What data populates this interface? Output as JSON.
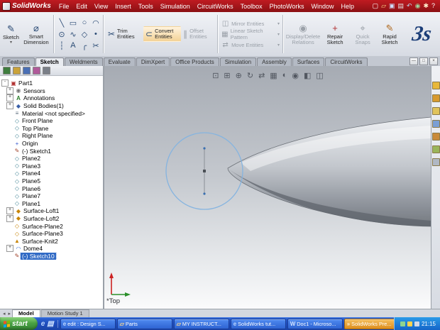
{
  "titlebar": {
    "app_name": "SolidWorks",
    "menus": [
      "File",
      "Edit",
      "View",
      "Insert",
      "Tools",
      "Simulation",
      "CircuitWorks",
      "Toolbox",
      "PhotoWorks",
      "Window",
      "Help"
    ],
    "icons": [
      {
        "name": "new-icon",
        "glyph": "▢",
        "color": "#ffffff"
      },
      {
        "name": "open-icon",
        "glyph": "▱",
        "color": "#ffd98a"
      },
      {
        "name": "save-icon",
        "glyph": "▣",
        "color": "#cfe0ff"
      },
      {
        "name": "print-icon",
        "glyph": "▤",
        "color": "#e8e8e8"
      },
      {
        "name": "undo-icon",
        "glyph": "↶",
        "color": "#bcd4ee"
      },
      {
        "name": "rebuild-icon",
        "glyph": "◉",
        "color": "#9fd89f"
      },
      {
        "name": "options-icon",
        "glyph": "✱",
        "color": "#ffeecc"
      },
      {
        "name": "help-icon",
        "glyph": "?",
        "color": "#ffffff"
      }
    ]
  },
  "command_manager": {
    "sketch": {
      "label": "Sketch",
      "glyph": "✎"
    },
    "smart_dimension": {
      "label": "Smart Dimension",
      "glyph": "⌀"
    },
    "entity_tools": [
      {
        "name": "line-icon",
        "glyph": "╲"
      },
      {
        "name": "rectangle-icon",
        "glyph": "▭"
      },
      {
        "name": "circle-icon",
        "glyph": "○"
      },
      {
        "name": "arc-icon",
        "glyph": "◠"
      },
      {
        "name": "ellipse-icon",
        "glyph": "⊙"
      },
      {
        "name": "spline-icon",
        "glyph": "∿"
      },
      {
        "name": "polygon-icon",
        "glyph": "◇"
      },
      {
        "name": "point-icon",
        "glyph": "•"
      },
      {
        "name": "centerline-icon",
        "glyph": "┆"
      },
      {
        "name": "text-icon",
        "glyph": "A"
      },
      {
        "name": "fillet-icon",
        "glyph": "╭"
      },
      {
        "name": "trim-small-icon",
        "glyph": "✂"
      }
    ],
    "trim": {
      "label": "Trim Entities",
      "glyph": "✂"
    },
    "convert": {
      "label": "Convert Entities",
      "glyph": "⊂"
    },
    "offset": {
      "label": "Offset Entities",
      "glyph": "∥"
    },
    "pattern_tools": [
      {
        "name": "mirror-entities-button",
        "label": "Mirror Entities",
        "glyph": "◫"
      },
      {
        "name": "linear-sketch-pattern-button",
        "label": "Linear Sketch Pattern",
        "glyph": "▦"
      },
      {
        "name": "move-entities-button",
        "label": "Move Entities",
        "glyph": "⇄"
      }
    ],
    "display_delete": {
      "label": "Display/Delete Relations",
      "glyph": "◉"
    },
    "repair": {
      "label": "Repair Sketch",
      "glyph": "+"
    },
    "quick_snaps": {
      "label": "Quick Snaps",
      "glyph": "⌖"
    },
    "rapid_sketch": {
      "label": "Rapid Sketch",
      "glyph": "✎"
    },
    "logo_text": "3s"
  },
  "tab_bar": {
    "tabs": [
      {
        "label": "Features"
      },
      {
        "label": "Sketch",
        "active": true
      },
      {
        "label": "Weldments"
      },
      {
        "label": "Evaluate"
      },
      {
        "label": "DimXpert"
      },
      {
        "label": "Office Products"
      },
      {
        "label": "Simulation"
      },
      {
        "label": "Assembly"
      },
      {
        "label": "Surfaces"
      },
      {
        "label": "CircuitWorks"
      }
    ],
    "window_controls": [
      {
        "name": "minimize-button",
        "glyph": "—"
      },
      {
        "name": "restore-button",
        "glyph": "□"
      },
      {
        "name": "close-button",
        "glyph": "×"
      }
    ]
  },
  "feature_tree": {
    "header_icons": [
      {
        "name": "featuremanager-tab-icon",
        "color": "#3f7d3f"
      },
      {
        "name": "propertymanager-tab-icon",
        "color": "#caa23a"
      },
      {
        "name": "configurationmanager-tab-icon",
        "color": "#4a6fb5"
      },
      {
        "name": "dimxpertmanager-tab-icon",
        "color": "#b05a9a"
      },
      {
        "name": "displaymanager-tab-icon",
        "color": "#7a7f88"
      }
    ],
    "root": {
      "label": "Part1",
      "expander": "-",
      "glyph": "▣"
    },
    "items": [
      {
        "label": "Sensors",
        "icon": "sensors",
        "glyph": "◉",
        "expander": "+"
      },
      {
        "label": "Annotations",
        "icon": "annotations",
        "glyph": "A",
        "expander": "+"
      },
      {
        "label": "Solid Bodies(1)",
        "icon": "bodies",
        "glyph": "◆",
        "expander": "+"
      },
      {
        "label": "Material <not specified>",
        "icon": "material",
        "glyph": "≡"
      },
      {
        "label": "Front Plane",
        "icon": "plane",
        "glyph": "◇"
      },
      {
        "label": "Top Plane",
        "icon": "plane",
        "glyph": "◇"
      },
      {
        "label": "Right Plane",
        "icon": "plane",
        "glyph": "◇"
      },
      {
        "label": "Origin",
        "icon": "origin",
        "glyph": "+"
      },
      {
        "label": "(-) Sketch1",
        "icon": "sketch",
        "glyph": "✎"
      },
      {
        "label": "Plane2",
        "icon": "plane",
        "glyph": "◇"
      },
      {
        "label": "Plane3",
        "icon": "plane",
        "glyph": "◇"
      },
      {
        "label": "Plane4",
        "icon": "plane",
        "glyph": "◇"
      },
      {
        "label": "Plane5",
        "icon": "plane",
        "glyph": "◇"
      },
      {
        "label": "Plane6",
        "icon": "plane",
        "glyph": "◇"
      },
      {
        "label": "Plane7",
        "icon": "plane",
        "glyph": "◇"
      },
      {
        "label": "Plane1",
        "icon": "plane",
        "glyph": "◇"
      },
      {
        "label": "Surface-Loft1",
        "icon": "surface",
        "glyph": "◆",
        "expander": "+"
      },
      {
        "label": "Surface-Loft2",
        "icon": "surface",
        "glyph": "◆",
        "expander": "+"
      },
      {
        "label": "Surface-Plane2",
        "icon": "surface",
        "glyph": "◇"
      },
      {
        "label": "Surface-Plane3",
        "icon": "surface",
        "glyph": "◇"
      },
      {
        "label": "Surface-Knit2",
        "icon": "surface",
        "glyph": "▲"
      },
      {
        "label": "Dome4",
        "icon": "dome",
        "glyph": "◠",
        "expander": "+"
      },
      {
        "label": "(-) Sketch10",
        "icon": "sketch",
        "glyph": "✎",
        "selected": true
      }
    ]
  },
  "viewport": {
    "view_label": "*Top",
    "toolbar_icons": [
      {
        "name": "zoom-fit-icon",
        "glyph": "⊡"
      },
      {
        "name": "zoom-area-icon",
        "glyph": "⊞"
      },
      {
        "name": "zoom-in-out-icon",
        "glyph": "⊕"
      },
      {
        "name": "rotate-view-icon",
        "glyph": "↻"
      },
      {
        "name": "pan-icon",
        "glyph": "⇄"
      },
      {
        "name": "view-orientation-icon",
        "glyph": "▦"
      },
      {
        "name": "display-style-icon",
        "glyph": "◐"
      },
      {
        "name": "hide-show-items-icon",
        "glyph": "◉"
      },
      {
        "name": "shadows-icon",
        "glyph": "◧"
      },
      {
        "name": "section-view-icon",
        "glyph": "◫"
      }
    ]
  },
  "task_pane": {
    "icons": [
      {
        "name": "solidworks-resources-icon",
        "color": "#e8b83a"
      },
      {
        "name": "design-library-icon",
        "color": "#d89a2e"
      },
      {
        "name": "file-explorer-icon",
        "color": "#e0c35a"
      },
      {
        "name": "search-icon",
        "color": "#7a9fd4"
      },
      {
        "name": "view-palette-icon",
        "color": "#c98a3a"
      },
      {
        "name": "appearances-icon",
        "color": "#9ab55a"
      },
      {
        "name": "custom-properties-icon",
        "color": "#b0b8c4"
      }
    ]
  },
  "document_tabs": {
    "nav_icons": [
      {
        "name": "tab-scroll-left-icon",
        "glyph": "◂"
      },
      {
        "name": "tab-scroll-right-icon",
        "glyph": "▸"
      }
    ],
    "tabs": [
      {
        "label": "Model",
        "active": true
      },
      {
        "label": "Motion Study 1"
      }
    ]
  },
  "taskbar": {
    "start_label": "start",
    "quick_launch": [
      {
        "name": "internet-explorer-icon",
        "glyph": "e",
        "color": "#bcd6ff"
      },
      {
        "name": "show-desktop-icon",
        "glyph": "▤",
        "color": "#cfe2ff"
      }
    ],
    "tasks": [
      {
        "label": "edit : Design S...",
        "icon": "internet-explorer",
        "glyph": "e",
        "icon_color": "#bcd6ff"
      },
      {
        "label": "Parts",
        "icon": "folder",
        "glyph": "▱",
        "icon_color": "#ffd98a"
      },
      {
        "label": "MY INSTRUCT...",
        "icon": "folder",
        "glyph": "▱",
        "icon_color": "#ffd98a"
      },
      {
        "label": "SolidWorks tut...",
        "icon": "internet-explorer",
        "glyph": "e",
        "icon_color": "#bcd6ff"
      },
      {
        "label": "Doc1 - Microso...",
        "icon": "word",
        "glyph": "W",
        "icon_color": "#cfe0ff"
      },
      {
        "label": "SolidWorks Pre...",
        "icon": "solidworks",
        "glyph": "»",
        "icon_color": "#fff2d8",
        "alert": true
      }
    ],
    "tray": {
      "icons": [
        {
          "name": "tray-network-icon",
          "color": "#8fd48f"
        },
        {
          "name": "tray-security-icon",
          "color": "#ffd24d"
        },
        {
          "name": "tray-volume-icon",
          "color": "#cfd8e8"
        }
      ],
      "time": "21:15"
    }
  }
}
